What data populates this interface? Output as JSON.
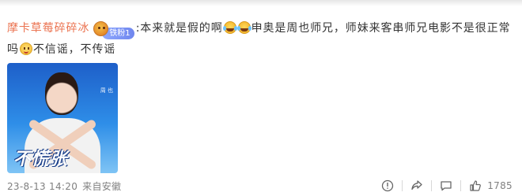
{
  "comment": {
    "username": "摩卡草莓碎碎冰",
    "fan_badge": "铁粉1",
    "segment_1": ":本来就是假的啊",
    "segment_2": "申奥是周也师兄，师妹来客串师兄电影不是很正常吗",
    "segment_3": "不信谣，不传谣",
    "emojis": [
      "laugh-cry-emoji",
      "laugh-cry-emoji",
      "smile-emoji"
    ]
  },
  "image": {
    "poster_name": "周 也",
    "poster_title": "不慌张"
  },
  "footer": {
    "date": "23-8-13 14:20",
    "source": "来自安徽",
    "like_count": "1785",
    "icons": [
      "report-icon",
      "share-icon",
      "comment-icon",
      "like-icon"
    ]
  },
  "colors": {
    "username": "#eb7350",
    "text": "#333333",
    "meta": "#808080",
    "badge": "#7b91f0"
  }
}
